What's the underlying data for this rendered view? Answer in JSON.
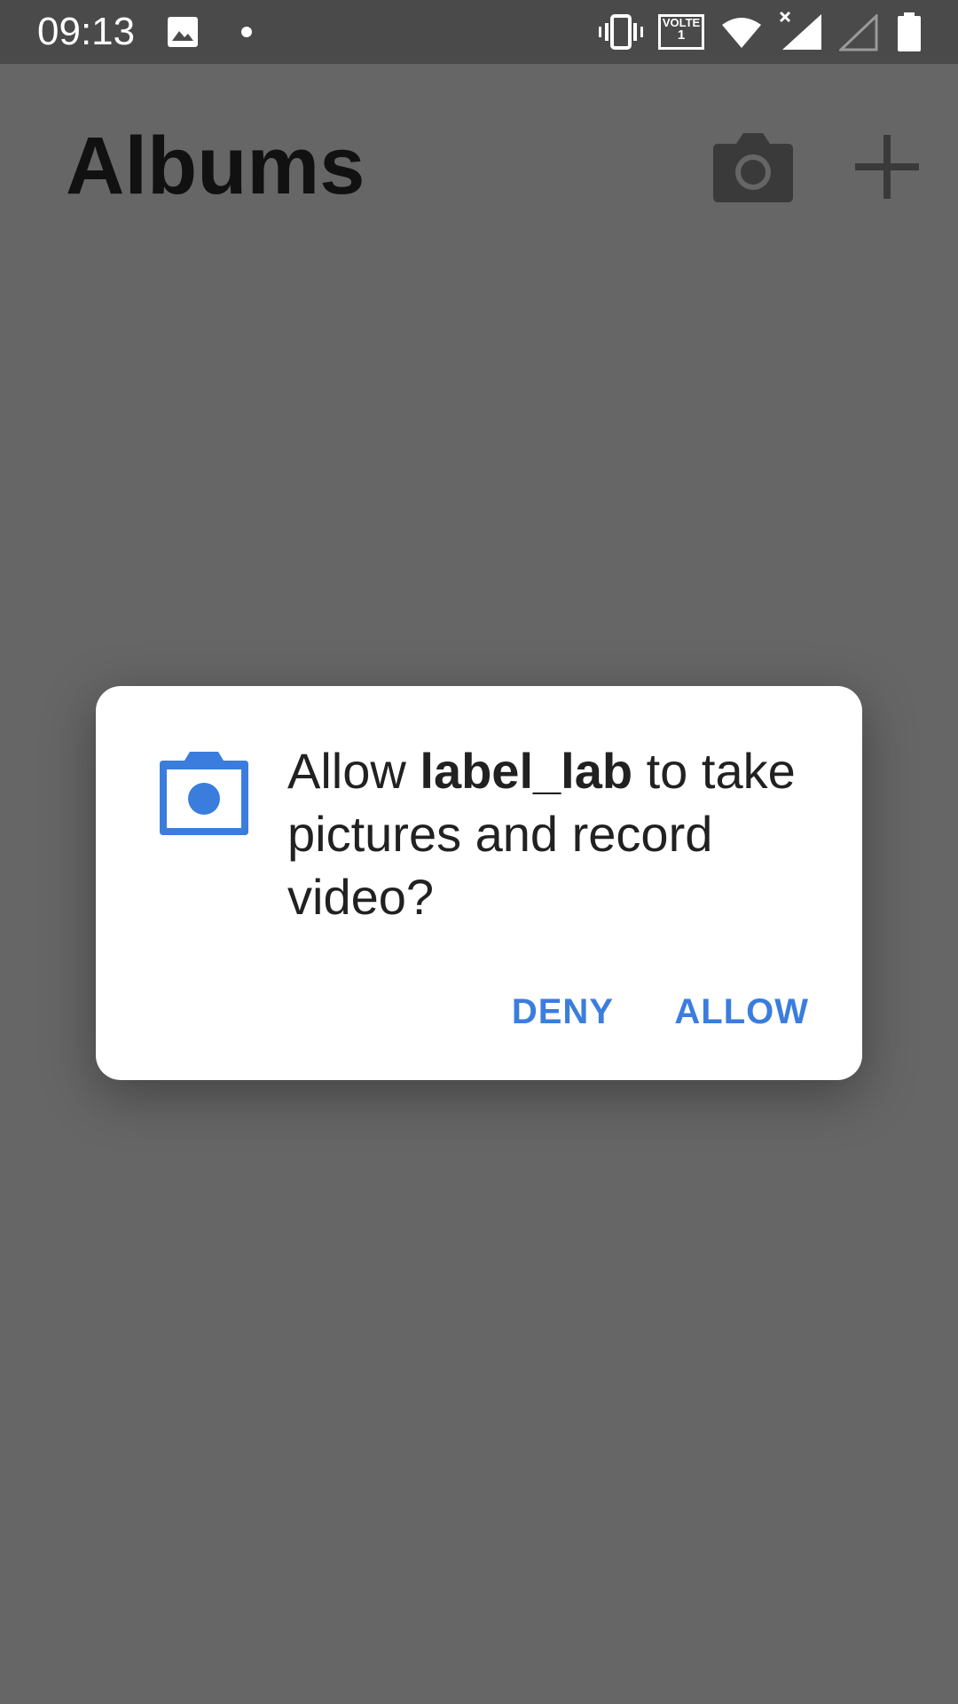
{
  "status_bar": {
    "time": "09:13",
    "network_label": "VOLTE",
    "sim_slot": "1"
  },
  "app": {
    "title": "Albums",
    "icons": [
      "camera-icon",
      "add-icon"
    ]
  },
  "dialog": {
    "text_prefix": "Allow ",
    "app_name": "label_lab",
    "text_suffix": " to take pictures and record video?",
    "deny_label": "DENY",
    "allow_label": "ALLOW",
    "icon": "camera-icon"
  },
  "colors": {
    "accent": "#3b7ddd",
    "scrim": "#666666",
    "status_bar": "#4a4a4a"
  }
}
